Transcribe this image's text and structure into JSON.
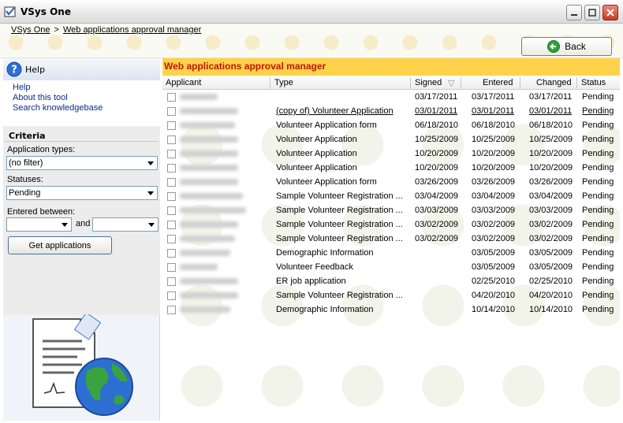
{
  "window": {
    "title": "VSys One"
  },
  "breadcrumb": {
    "root": "VSys One",
    "separator": ">",
    "current": "Web applications approval manager"
  },
  "toolbar": {
    "back_label": "Back"
  },
  "help": {
    "title": "Help",
    "links": [
      "Help",
      "About this tool",
      "Search knowledgebase"
    ]
  },
  "criteria": {
    "title": "Criteria",
    "app_types_label": "Application types:",
    "app_types_value": "(no filter)",
    "statuses_label": "Statuses:",
    "statuses_value": "Pending",
    "entered_between_label": "Entered between:",
    "and_label": "and",
    "date_from": "",
    "date_to": "",
    "get_button": "Get applications"
  },
  "main": {
    "title": "Web applications approval manager",
    "columns": [
      "Applicant",
      "Type",
      "Signed",
      "Entered",
      "Changed",
      "Status"
    ],
    "sort_indicator": "▽"
  },
  "rows": [
    {
      "type": "",
      "signed": "03/17/2011",
      "entered": "03/17/2011",
      "changed": "03/17/2011",
      "status": "Pending",
      "underline": false
    },
    {
      "type": "(copy of) Volunteer Application",
      "signed": "03/01/2011",
      "entered": "03/01/2011",
      "changed": "03/01/2011",
      "status": "Pending",
      "underline": true
    },
    {
      "type": "Volunteer Application form",
      "signed": "06/18/2010",
      "entered": "06/18/2010",
      "changed": "06/18/2010",
      "status": "Pending",
      "underline": false
    },
    {
      "type": "Volunteer Application",
      "signed": "10/25/2009",
      "entered": "10/25/2009",
      "changed": "10/25/2009",
      "status": "Pending",
      "underline": false
    },
    {
      "type": "Volunteer Application",
      "signed": "10/20/2009",
      "entered": "10/20/2009",
      "changed": "10/20/2009",
      "status": "Pending",
      "underline": false
    },
    {
      "type": "Volunteer Application",
      "signed": "10/20/2009",
      "entered": "10/20/2009",
      "changed": "10/20/2009",
      "status": "Pending",
      "underline": false
    },
    {
      "type": "Volunteer Application form",
      "signed": "03/26/2009",
      "entered": "03/26/2009",
      "changed": "03/26/2009",
      "status": "Pending",
      "underline": false
    },
    {
      "type": "Sample Volunteer Registration ...",
      "signed": "03/04/2009",
      "entered": "03/04/2009",
      "changed": "03/04/2009",
      "status": "Pending",
      "underline": false
    },
    {
      "type": "Sample Volunteer Registration ...",
      "signed": "03/03/2009",
      "entered": "03/03/2009",
      "changed": "03/03/2009",
      "status": "Pending",
      "underline": false
    },
    {
      "type": "Sample Volunteer Registration ...",
      "signed": "03/02/2009",
      "entered": "03/02/2009",
      "changed": "03/02/2009",
      "status": "Pending",
      "underline": false
    },
    {
      "type": "Sample Volunteer Registration ...",
      "signed": "03/02/2009",
      "entered": "03/02/2009",
      "changed": "03/02/2009",
      "status": "Pending",
      "underline": false
    },
    {
      "type": "Demographic Information",
      "signed": "",
      "entered": "03/05/2009",
      "changed": "03/05/2009",
      "status": "Pending",
      "underline": false
    },
    {
      "type": "Volunteer Feedback",
      "signed": "",
      "entered": "03/05/2009",
      "changed": "03/05/2009",
      "status": "Pending",
      "underline": false
    },
    {
      "type": "ER job application",
      "signed": "",
      "entered": "02/25/2010",
      "changed": "02/25/2010",
      "status": "Pending",
      "underline": false
    },
    {
      "type": "Sample Volunteer Registration ...",
      "signed": "",
      "entered": "04/20/2010",
      "changed": "04/20/2010",
      "status": "Pending",
      "underline": false
    },
    {
      "type": "Demographic Information",
      "signed": "",
      "entered": "10/14/2010",
      "changed": "10/14/2010",
      "status": "Pending",
      "underline": false
    }
  ],
  "colors": {
    "title_band": "#ffd24a",
    "title_text": "#c0150b",
    "link": "#0b2b8a"
  }
}
